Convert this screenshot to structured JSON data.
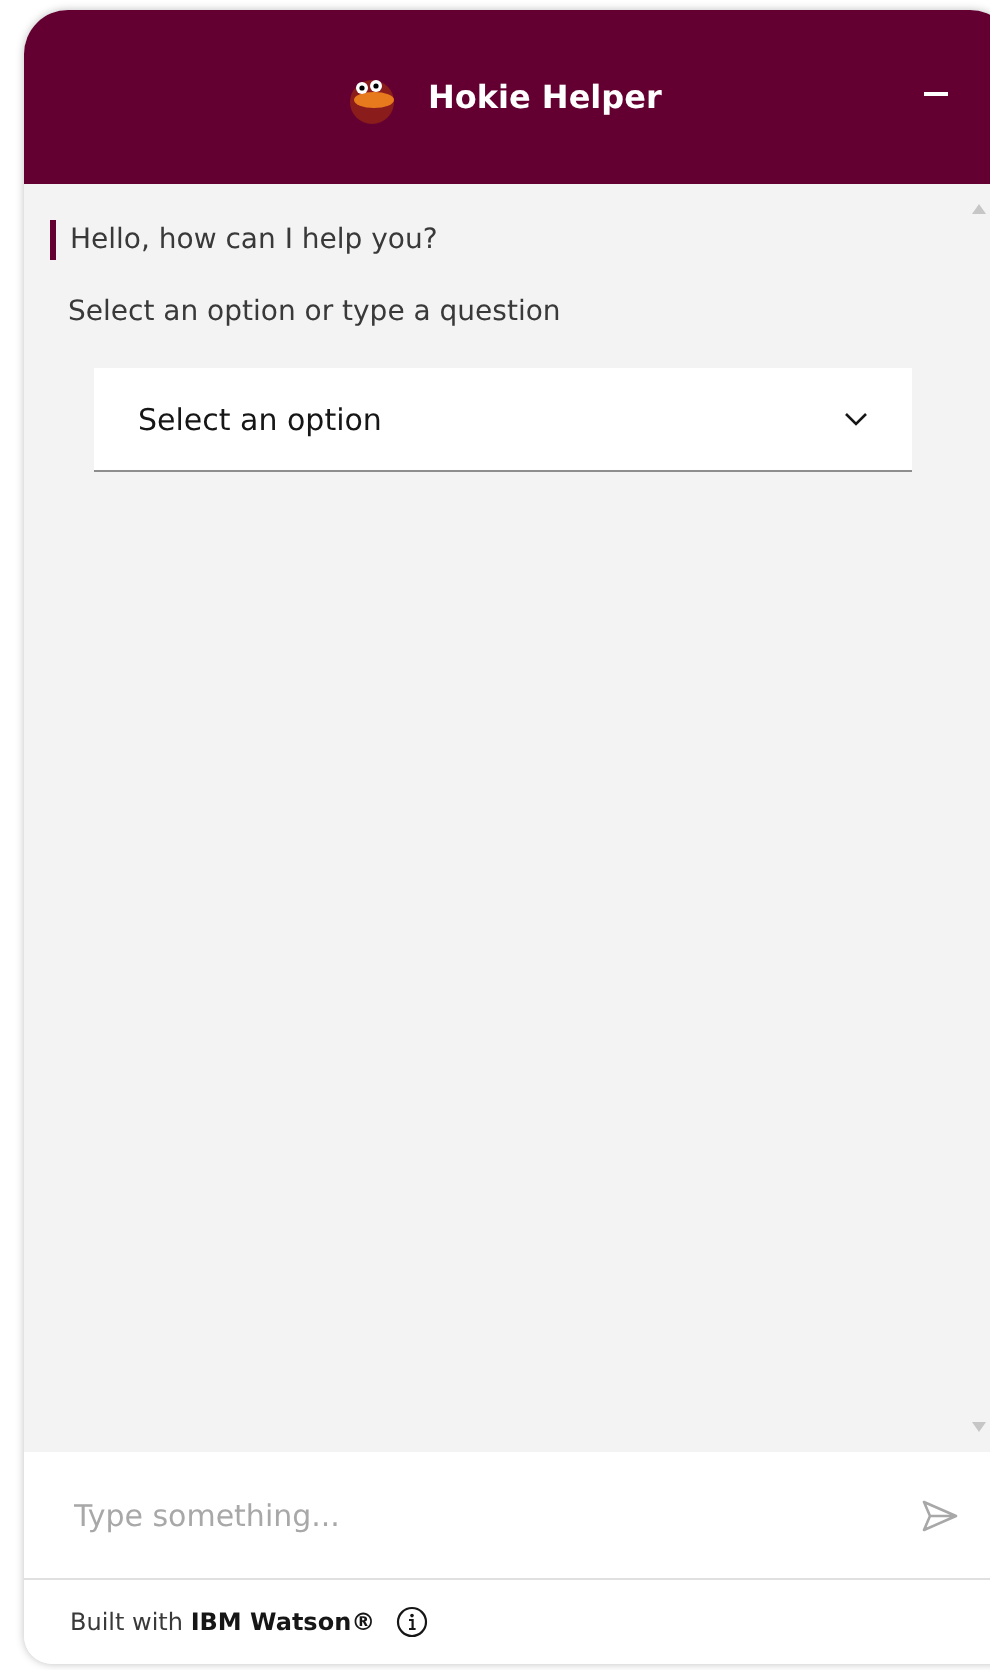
{
  "header": {
    "title": "Hokie Helper"
  },
  "messages": [
    {
      "kind": "accent",
      "text": "Hello, how can I help you?"
    },
    {
      "kind": "plain",
      "text": "Select an option or type a question"
    }
  ],
  "dropdown": {
    "placeholder": "Select an option"
  },
  "composer": {
    "placeholder": "Type something..."
  },
  "footer": {
    "text": "Built with **IBM Watson®**"
  }
}
